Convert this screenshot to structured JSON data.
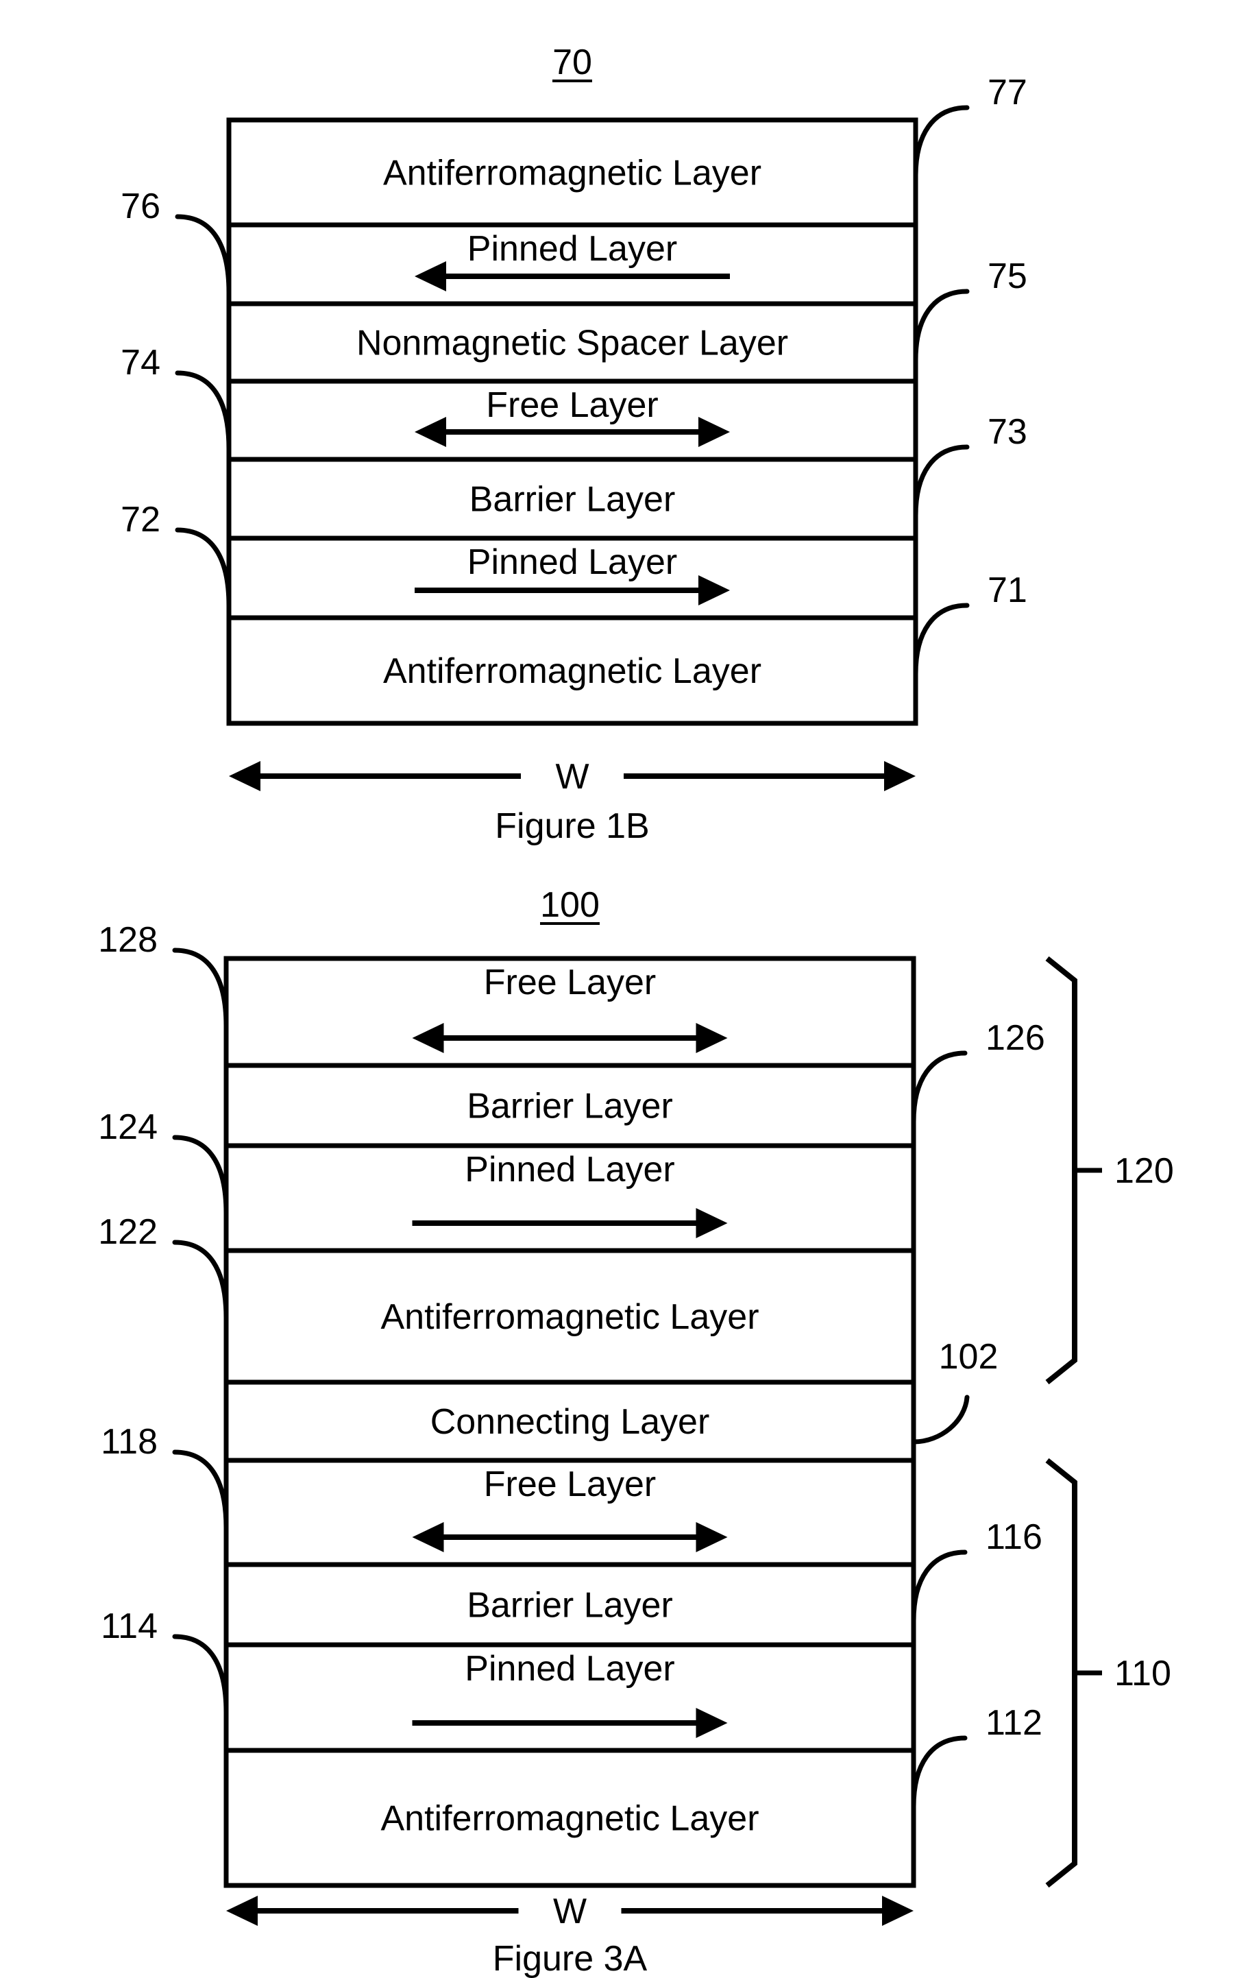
{
  "figures": [
    {
      "number": "70",
      "caption": "Figure 1B",
      "width_label": "W",
      "layers": [
        {
          "label": "Antiferromagnetic Layer",
          "arrow": "none",
          "ref": "77",
          "ref_side": "right"
        },
        {
          "label": "Pinned Layer",
          "arrow": "left",
          "ref": "76",
          "ref_side": "left"
        },
        {
          "label": "Nonmagnetic Spacer Layer",
          "arrow": "none",
          "ref": "75",
          "ref_side": "right"
        },
        {
          "label": "Free Layer",
          "arrow": "both",
          "ref": "74",
          "ref_side": "left"
        },
        {
          "label": "Barrier Layer",
          "arrow": "none",
          "ref": "73",
          "ref_side": "right"
        },
        {
          "label": "Pinned Layer",
          "arrow": "right",
          "ref": "72",
          "ref_side": "left"
        },
        {
          "label": "Antiferromagnetic Layer",
          "arrow": "none",
          "ref": "71",
          "ref_side": "right"
        }
      ],
      "groups": []
    },
    {
      "number": "100",
      "caption": "Figure 3A",
      "width_label": "W",
      "layers": [
        {
          "label": "Free Layer",
          "arrow": "both",
          "ref": "128",
          "ref_side": "left"
        },
        {
          "label": "Barrier Layer",
          "arrow": "none",
          "ref": "126",
          "ref_side": "right"
        },
        {
          "label": "Pinned Layer",
          "arrow": "right",
          "ref": "124",
          "ref_side": "left"
        },
        {
          "label": "Antiferromagnetic Layer",
          "arrow": "none",
          "ref": "122",
          "ref_side": "left"
        },
        {
          "label": "Connecting Layer",
          "arrow": "none",
          "ref": "102",
          "ref_side": "right"
        },
        {
          "label": "Free Layer",
          "arrow": "both",
          "ref": "118",
          "ref_side": "left"
        },
        {
          "label": "Barrier Layer",
          "arrow": "none",
          "ref": "116",
          "ref_side": "right"
        },
        {
          "label": "Pinned Layer",
          "arrow": "right",
          "ref": "114",
          "ref_side": "left"
        },
        {
          "label": "Antiferromagnetic Layer",
          "arrow": "none",
          "ref": "112",
          "ref_side": "right"
        }
      ],
      "groups": [
        {
          "ref": "120",
          "from_layer": 0,
          "to_layer": 3
        },
        {
          "ref": "110",
          "from_layer": 5,
          "to_layer": 8
        }
      ]
    }
  ]
}
